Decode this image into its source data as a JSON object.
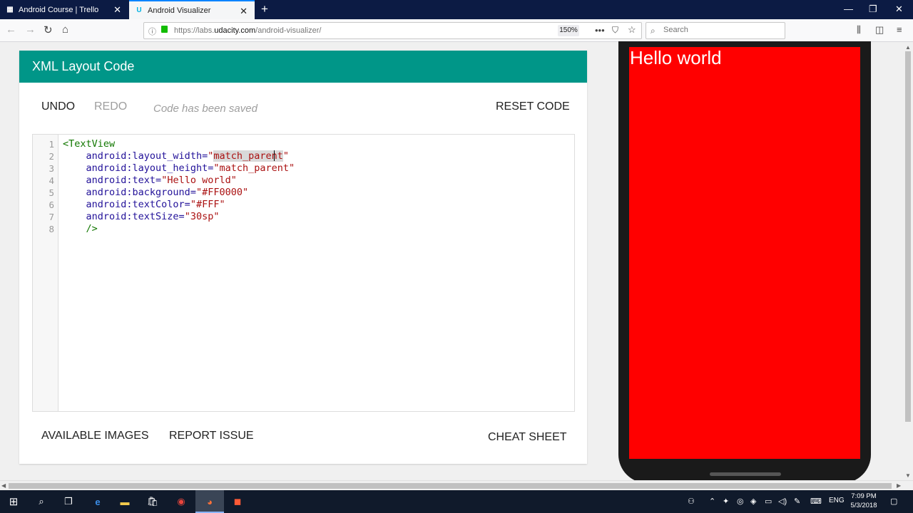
{
  "browser": {
    "tabs": [
      {
        "label": "Android Course | Trello",
        "active": false
      },
      {
        "label": "Android Visualizer",
        "active": true
      }
    ],
    "url_prefix": "https://labs.",
    "url_domain": "udacity.com",
    "url_path": "/android-visualizer/",
    "zoom": "150%",
    "search_placeholder": "Search"
  },
  "editor_card": {
    "title": "XML Layout Code",
    "undo_label": "UNDO",
    "redo_label": "REDO",
    "saved_status": "Code has been saved",
    "reset_label": "RESET CODE",
    "available_images_label": "AVAILABLE IMAGES",
    "report_issue_label": "REPORT ISSUE",
    "cheat_sheet_label": "CHEAT SHEET",
    "code_lines": [
      {
        "n": "1",
        "indent": "",
        "tag": "<TextView",
        "attr": "",
        "value": ""
      },
      {
        "n": "2",
        "indent": "    ",
        "tag": "",
        "attr": "android:layout_width=",
        "value": "\"match_parent\""
      },
      {
        "n": "3",
        "indent": "    ",
        "tag": "",
        "attr": "android:layout_height=",
        "value": "\"match_parent\""
      },
      {
        "n": "4",
        "indent": "    ",
        "tag": "",
        "attr": "android:text=",
        "value": "\"Hello world\""
      },
      {
        "n": "5",
        "indent": "    ",
        "tag": "",
        "attr": "android:background=",
        "value": "\"#FF0000\""
      },
      {
        "n": "6",
        "indent": "    ",
        "tag": "",
        "attr": "android:textColor=",
        "value": "\"#FFF\""
      },
      {
        "n": "7",
        "indent": "    ",
        "tag": "",
        "attr": "android:textSize=",
        "value": "\"30sp\""
      },
      {
        "n": "8",
        "indent": "    ",
        "tag": "/>",
        "attr": "",
        "value": ""
      }
    ]
  },
  "preview": {
    "text": "Hello world",
    "background": "#FF0000",
    "text_color": "#FFFFFF"
  },
  "taskbar": {
    "language": "ENG",
    "time": "7:09 PM",
    "date": "5/3/2018"
  },
  "colors": {
    "header": "#009688",
    "tab_bar": "#0c1b44",
    "taskbar": "#101a2b"
  }
}
